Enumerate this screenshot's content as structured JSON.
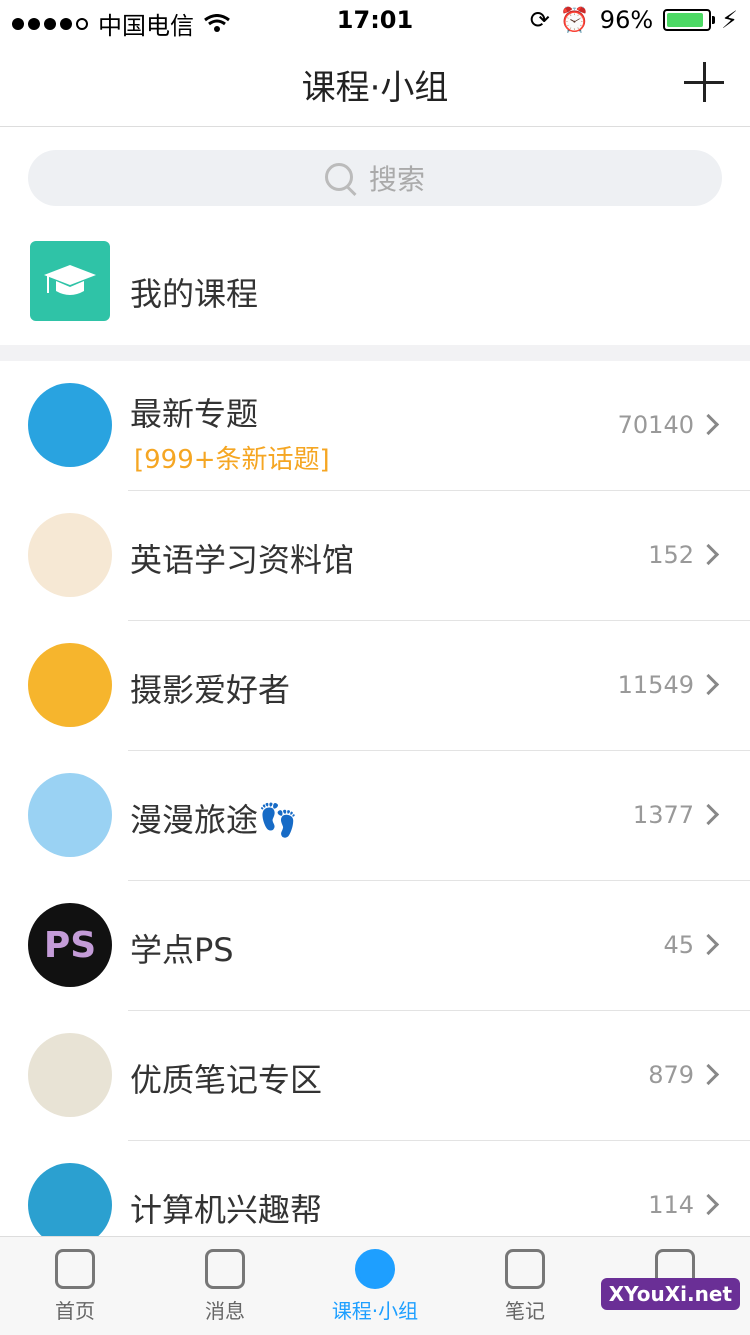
{
  "status": {
    "carrier": "中国电信",
    "time": "17:01",
    "battery": "96%"
  },
  "header": {
    "title": "课程·小组"
  },
  "search": {
    "placeholder": "搜索"
  },
  "my_course": {
    "label": "我的课程"
  },
  "groups": [
    {
      "name": "最新专题",
      "sub": "[999+条新话题]",
      "count": "70140"
    },
    {
      "name": "英语学习资料馆",
      "count": "152"
    },
    {
      "name": "摄影爱好者",
      "count": "11549"
    },
    {
      "name": "漫漫旅途👣",
      "count": "1377"
    },
    {
      "name": "学点PS",
      "count": "45"
    },
    {
      "name": "优质笔记专区",
      "count": "879"
    },
    {
      "name": "计算机兴趣帮",
      "count": "114"
    }
  ],
  "tabs": [
    {
      "label": "首页"
    },
    {
      "label": "消息"
    },
    {
      "label": "课程·小组"
    },
    {
      "label": "笔记"
    },
    {
      "label": ""
    }
  ],
  "watermark": "XYouXi.net",
  "accent": "#1e9fff",
  "icons": {
    "my_course": "graduation-cap-icon",
    "chevron": "chevron-right-icon"
  }
}
